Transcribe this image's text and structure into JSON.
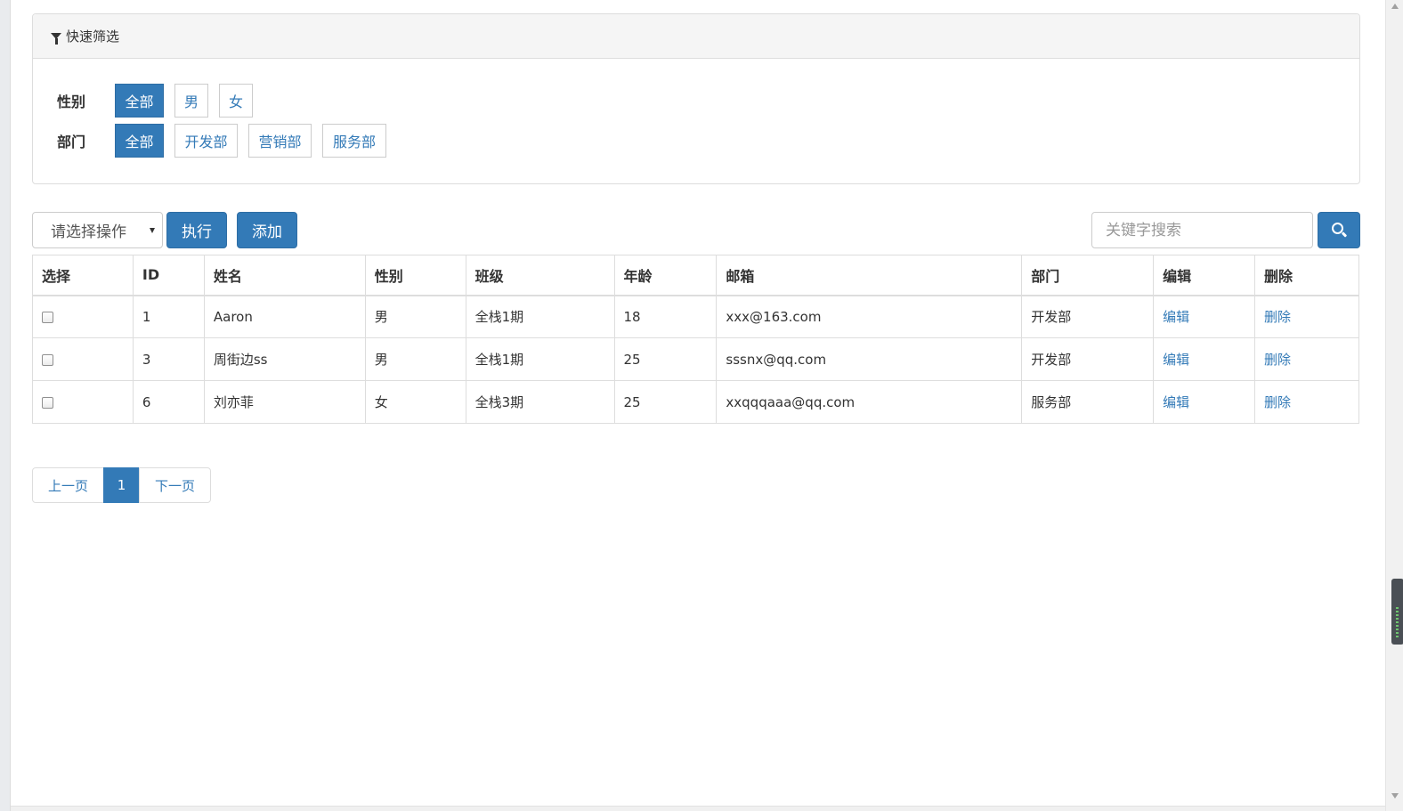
{
  "filter_panel": {
    "title": "快速筛选",
    "gender": {
      "label": "性别",
      "options": [
        "全部",
        "男",
        "女"
      ],
      "active": "全部"
    },
    "department": {
      "label": "部门",
      "options": [
        "全部",
        "开发部",
        "营销部",
        "服务部"
      ],
      "active": "全部"
    }
  },
  "toolbar": {
    "select_placeholder": "请选择操作",
    "execute_label": "执行",
    "add_label": "添加",
    "search_placeholder": "关键字搜索"
  },
  "table": {
    "headers": [
      "选择",
      "ID",
      "姓名",
      "性别",
      "班级",
      "年龄",
      "邮箱",
      "部门",
      "编辑",
      "删除"
    ],
    "rows": [
      {
        "id": "1",
        "name": "Aaron",
        "gender": "男",
        "class": "全栈1期",
        "age": "18",
        "email": "xxx@163.com",
        "dept": "开发部",
        "edit": "编辑",
        "delete": "删除"
      },
      {
        "id": "3",
        "name": "周街边ss",
        "gender": "男",
        "class": "全栈1期",
        "age": "25",
        "email": "sssnx@qq.com",
        "dept": "开发部",
        "edit": "编辑",
        "delete": "删除"
      },
      {
        "id": "6",
        "name": "刘亦菲",
        "gender": "女",
        "class": "全栈3期",
        "age": "25",
        "email": "xxqqqaaa@qq.com",
        "dept": "服务部",
        "edit": "编辑",
        "delete": "删除"
      }
    ]
  },
  "pagination": {
    "prev_label": "上一页",
    "current_page": "1",
    "next_label": "下一页"
  },
  "colors": {
    "primary": "#337ab7",
    "border": "#dddddd",
    "panel_heading": "#f5f5f5"
  }
}
